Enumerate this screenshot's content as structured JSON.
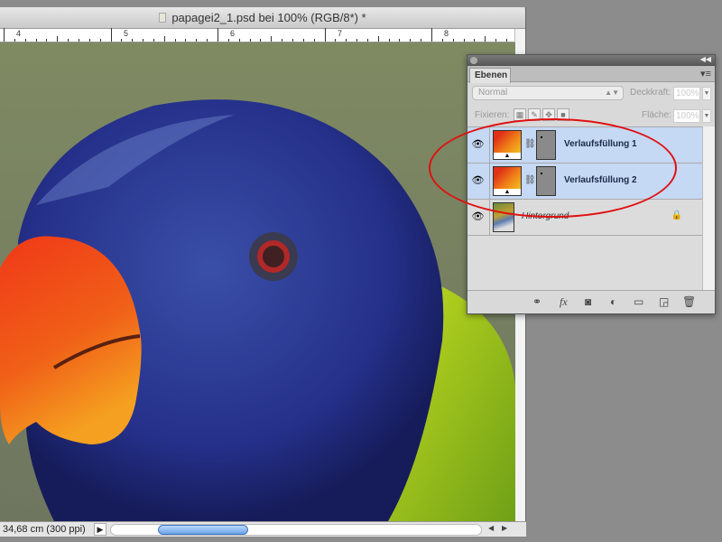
{
  "document": {
    "title": "papagei2_1.psd bei 100% (RGB/8*) *",
    "ruler_labels": [
      "4",
      "5",
      "6",
      "7",
      "8"
    ],
    "status": "34,68 cm (300 ppi)"
  },
  "layers_panel": {
    "tab": "Ebenen",
    "blend_mode": "Normal",
    "opacity_label": "Deckkraft:",
    "opacity_value": "100%",
    "lock_label": "Fixieren:",
    "fill_label": "Fläche:",
    "fill_value": "100%",
    "layers": [
      {
        "name": "Verlaufsfüllung 1",
        "selected": true
      },
      {
        "name": "Verlaufsfüllung 2",
        "selected": true
      },
      {
        "name": "Hintergrund",
        "selected": false,
        "locked": true
      }
    ]
  },
  "colors": {
    "highlight": "#e01010",
    "selection": "#c5d8f4"
  }
}
